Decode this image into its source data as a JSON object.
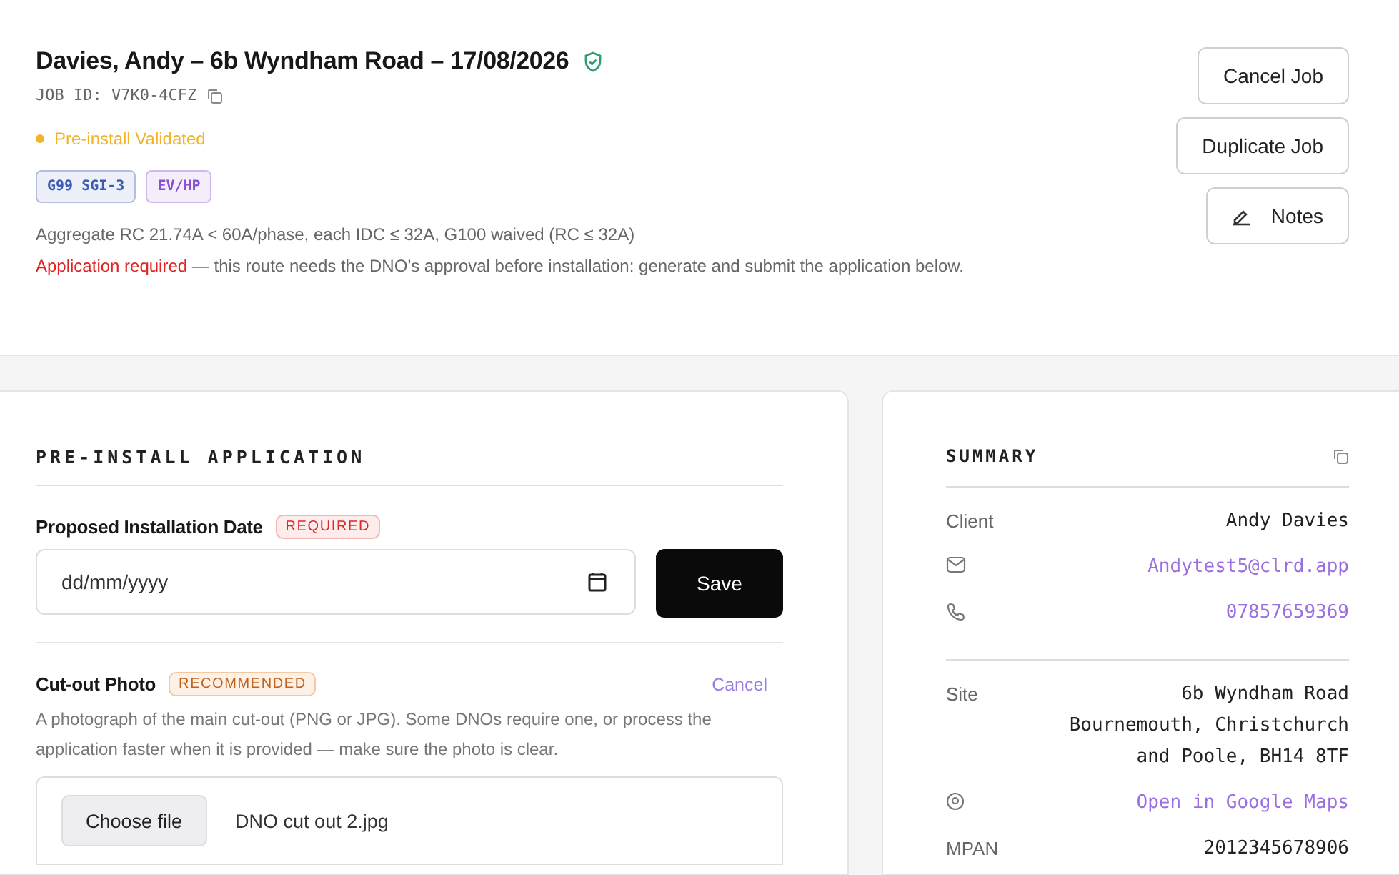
{
  "job": {
    "title": "Davies, Andy – 6b Wyndham Road – 17/08/2026",
    "verified": true,
    "job_id": "JOB ID: V7K0-4CFZ",
    "status": {
      "label": "Pre-install Validated",
      "color": "#f0b429"
    },
    "tags": [
      {
        "label": "G99 SGI-3",
        "color": "#3b5bb5"
      },
      {
        "label": "EV/HP",
        "color": "#8b4fd6"
      }
    ],
    "rule": "Aggregate RC 21.74A < 60A/phase, each IDC ≤ 32A, G100 waived (RC ≤ 32A)",
    "notice": {
      "highlight": "Application required",
      "text": " — this route needs the DNO’s approval before installation: generate and submit the application below."
    },
    "actions": [
      {
        "label": "Cancel Job",
        "kind": "plain"
      },
      {
        "label": "Duplicate Job",
        "kind": "plain"
      },
      {
        "label": "Notes",
        "kind": "pencil"
      }
    ]
  },
  "application": {
    "title": "PRE-INSTALL APPLICATION",
    "date_field": {
      "label": "Proposed Installation Date",
      "badge": "REQUIRED",
      "placeholder": "dd/mm/yyyy",
      "button": "Save"
    },
    "photo_field": {
      "label": "Cut-out Photo",
      "badge": "RECOMMENDED",
      "action": "Cancel",
      "help": "A photograph of the main cut-out (PNG or JPG). Some DNOs require one, or process the application faster when it is provided — make sure the photo is clear.",
      "choose_button": "Choose file",
      "file_name": "DNO cut out 2.jpg"
    }
  },
  "summary": {
    "title": "SUMMARY",
    "groups": [
      [
        {
          "kind": "label",
          "label": "Client",
          "value": "Andy Davies"
        },
        {
          "kind": "email",
          "value": "Andytest5@clrd.app"
        },
        {
          "kind": "phone",
          "value": "07857659369"
        }
      ],
      [
        {
          "kind": "label",
          "label": "Site",
          "value": "6b Wyndham Road\nBournemouth, Christchurch\nand Poole, BH14 8TF"
        },
        {
          "kind": "map",
          "value": "Open in Google Maps"
        },
        {
          "kind": "label",
          "label": "MPAN",
          "value": "2012345678906"
        }
      ]
    ]
  }
}
